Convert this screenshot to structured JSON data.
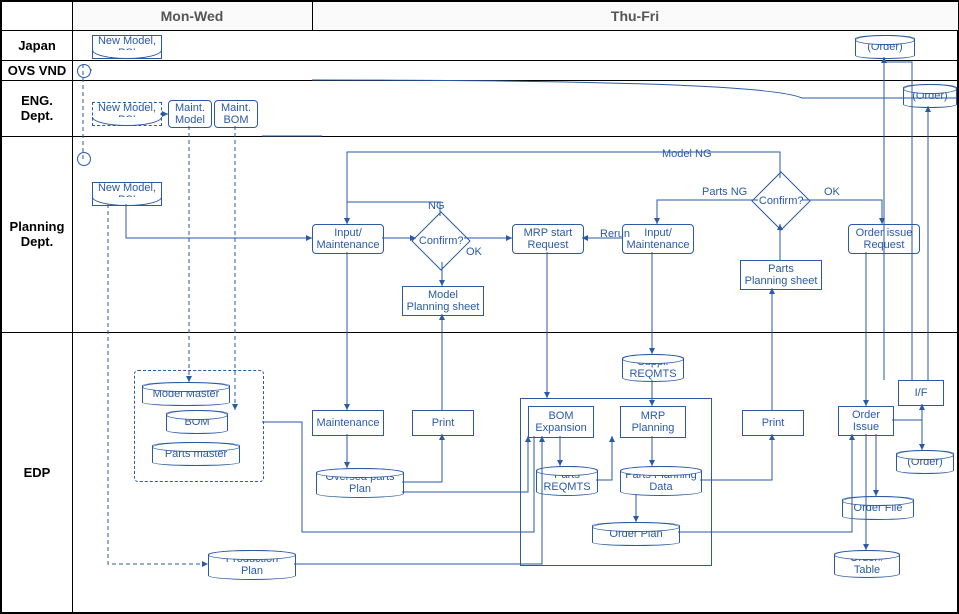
{
  "columns": {
    "mon_wed": "Mon-Wed",
    "thu_fri": "Thu-Fri"
  },
  "rows": {
    "japan": "Japan",
    "ovs_vnd": "OVS VND",
    "eng_dept": "ENG.\nDept.",
    "planning_dept": "Planning\nDept.",
    "edp": "EDP"
  },
  "nodes": {
    "japan_newmodel": "New Model,\nPSI",
    "japan_order": "(Order)",
    "ovs_order": "(Order)",
    "eng_newmodel": "New Model,\nPSI",
    "eng_maint_model": "Maint.\nModel",
    "eng_maint_bom": "Maint.\nBOM",
    "plan_newmodel": "New Model,\nPSI",
    "plan_input_maint": "Input/\nMaintenance",
    "plan_confirm1": "Confirm?",
    "plan_model_sheet": "Model\nPlanning sheet",
    "plan_mrp_start": "MRP start\nRequest",
    "plan_input_maint2": "Input/\nMaintenance",
    "plan_confirm2": "Confirm?",
    "plan_parts_sheet": "Parts\nPlanning sheet",
    "plan_order_issue_req": "Order issue\nRequest",
    "edp_model_master": "Model Master",
    "edp_bom": "BOM",
    "edp_parts_master": "Parts master",
    "edp_maintenance": "Maintenance",
    "edp_print1": "Print",
    "edp_oversea_plan": "Oversea parts\nPlan",
    "edp_production_plan": "Production\nPlan",
    "edp_bom_expansion": "BOM\nExpansion",
    "edp_mrp_planning": "MRP\nPlanning",
    "edp_suppl_reqmts": "Suppl.\nREQMTS",
    "edp_parts_reqmts": "Parts\nREQMTS",
    "edp_parts_plan_data": "Parts Planning\nData",
    "edp_order_plan": "Order Plan",
    "edp_print2": "Print",
    "edp_order_issue": "Order\nIssue",
    "edp_order_cyl": "(Order)",
    "edp_order_file": "Order File",
    "edp_ordernum_table": "Order#\nTable",
    "edp_if": "I/F"
  },
  "labels": {
    "ng": "NG",
    "ok": "OK",
    "model_ng": "Model NG",
    "parts_ng": "Parts NG",
    "rerun": "Rerun"
  }
}
